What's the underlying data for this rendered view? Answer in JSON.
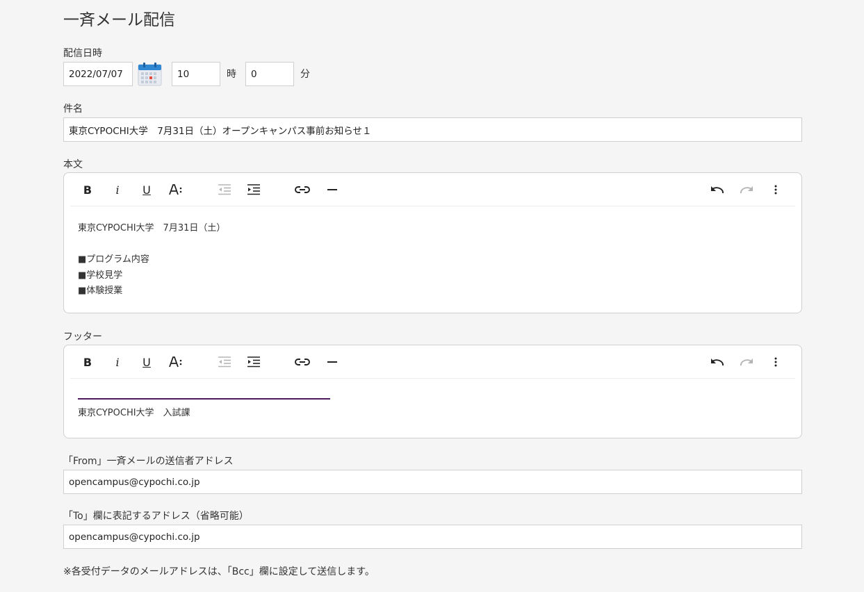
{
  "page": {
    "title": "一斉メール配信"
  },
  "delivery": {
    "label": "配信日時",
    "date": "2022/07/07",
    "hour": "10",
    "hour_unit": "時",
    "minute": "0",
    "minute_unit": "分",
    "calendar_icon": "calendar-icon"
  },
  "subject": {
    "label": "件名",
    "value": "東京CYPOCHI大学　7月31日（土）オープンキャンパス事前お知らせ１"
  },
  "body": {
    "label": "本文",
    "lines": [
      "東京CYPOCHI大学　7月31日（土）",
      "",
      "■プログラム内容",
      "■学校見学",
      "■体験授業"
    ]
  },
  "footer": {
    "label": "フッター",
    "lines": [
      "東京CYPOCHI大学　入試課"
    ],
    "rule_color": "#4a1a5c"
  },
  "toolbar": {
    "bold": "B",
    "italic": "i",
    "underline": "U",
    "icons": [
      "bold-icon",
      "italic-icon",
      "underline-icon",
      "font-size-icon",
      "outdent-icon",
      "indent-icon",
      "link-icon",
      "horizontal-rule-icon",
      "undo-icon",
      "redo-icon",
      "more-vertical-icon"
    ]
  },
  "from": {
    "label": "「From」一斉メールの送信者アドレス",
    "value": "opencampus@cypochi.co.jp"
  },
  "to": {
    "label": "「To」欄に表記するアドレス（省略可能）",
    "value": "opencampus@cypochi.co.jp"
  },
  "note": "※各受付データのメールアドレスは、「Bcc」欄に設定して送信します。"
}
